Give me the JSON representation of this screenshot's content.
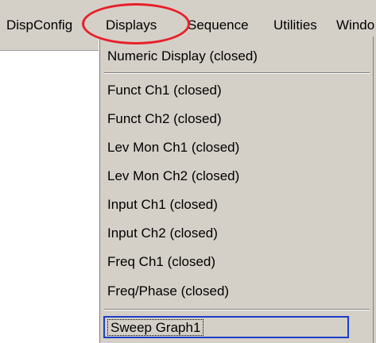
{
  "menubar": {
    "items": [
      {
        "label": "DispConfig"
      },
      {
        "label": "Displays"
      },
      {
        "label": "Sequence"
      },
      {
        "label": "Utilities"
      },
      {
        "label": "Windo"
      }
    ]
  },
  "displays_menu": {
    "items": [
      {
        "label": "Numeric Display (closed)"
      },
      {
        "label": "Funct Ch1 (closed)"
      },
      {
        "label": "Funct Ch2 (closed)"
      },
      {
        "label": "Lev Mon Ch1 (closed)"
      },
      {
        "label": "Lev Mon Ch2 (closed)"
      },
      {
        "label": "Input Ch1 (closed)"
      },
      {
        "label": "Input Ch2 (closed)"
      },
      {
        "label": "Freq Ch1 (closed)"
      },
      {
        "label": "Freq/Phase (closed)"
      },
      {
        "label": "Sweep Graph1"
      }
    ]
  },
  "colors": {
    "menu_background": "#d4d0c8",
    "highlight_ellipse": "#e8202a",
    "selection_border": "#1c3ec8"
  }
}
